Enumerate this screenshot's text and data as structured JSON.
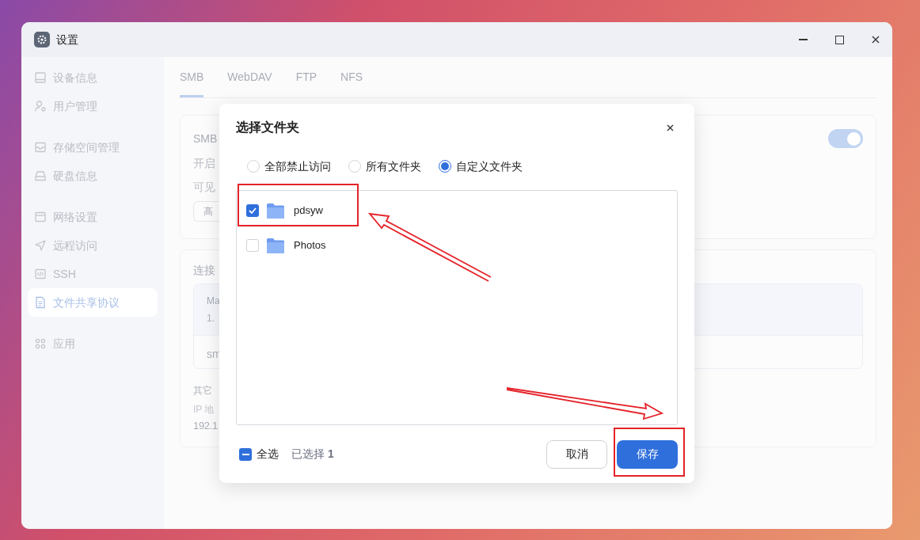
{
  "window": {
    "title": "设置"
  },
  "sidebar": {
    "groups": [
      [
        {
          "label": "设备信息",
          "selected": false
        },
        {
          "label": "用户管理",
          "selected": false
        }
      ],
      [
        {
          "label": "存储空间管理",
          "selected": false
        },
        {
          "label": "硬盘信息",
          "selected": false
        }
      ],
      [
        {
          "label": "网络设置",
          "selected": false
        },
        {
          "label": "远程访问",
          "selected": false
        },
        {
          "label": "SSH",
          "selected": false
        },
        {
          "label": "文件共享协议",
          "selected": true
        }
      ],
      [
        {
          "label": "应用",
          "selected": false
        }
      ]
    ]
  },
  "tabs": [
    {
      "label": "SMB",
      "selected": true
    },
    {
      "label": "WebDAV",
      "selected": false
    },
    {
      "label": "FTP",
      "selected": false
    },
    {
      "label": "NFS",
      "selected": false
    }
  ],
  "smb_card": {
    "title": "SMB",
    "enabled": true,
    "lines": [
      "开启",
      "可见"
    ],
    "button": "高"
  },
  "connection_card": {
    "title": "连接",
    "panel_header": "Ma",
    "panel_line": "1.",
    "panel_footer": "sm",
    "other_label": "其它",
    "ip_label": "IP 地",
    "ip_value": "192.1"
  },
  "dialog": {
    "title": "选择文件夹",
    "radios": [
      {
        "label": "全部禁止访问",
        "selected": false
      },
      {
        "label": "所有文件夹",
        "selected": false
      },
      {
        "label": "自定义文件夹",
        "selected": true
      }
    ],
    "folders": [
      {
        "name": "pdsyw",
        "checked": true
      },
      {
        "name": "Photos",
        "checked": false
      }
    ],
    "select_all": {
      "label": "全选",
      "indeterminate": true
    },
    "selected_count": "已选择 **1**",
    "buttons": [
      {
        "label": "取消",
        "kind": "secondary"
      },
      {
        "label": "保存",
        "kind": "primary"
      }
    ]
  }
}
